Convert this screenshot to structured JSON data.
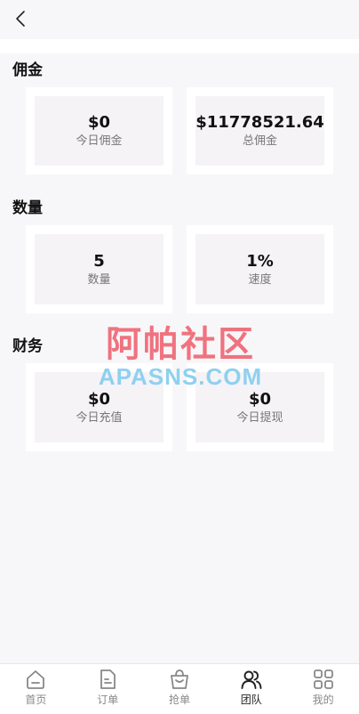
{
  "sections": [
    {
      "title": "佣金",
      "cards": [
        {
          "value": "$0",
          "label": "今日佣金"
        },
        {
          "value": "$11778521.64",
          "label": "总佣金"
        }
      ]
    },
    {
      "title": "数量",
      "cards": [
        {
          "value": "5",
          "label": "数量"
        },
        {
          "value": "1%",
          "label": "速度"
        }
      ]
    },
    {
      "title": "财务",
      "cards": [
        {
          "value": "$0",
          "label": "今日充值"
        },
        {
          "value": "$0",
          "label": "今日提现"
        }
      ]
    }
  ],
  "watermark": {
    "cn": "阿帕社区",
    "en": "APASNS.COM"
  },
  "tabbar": {
    "items": [
      {
        "label": "首页",
        "icon": "home-icon"
      },
      {
        "label": "订单",
        "icon": "document-icon"
      },
      {
        "label": "抢单",
        "icon": "shopping-bag-icon"
      },
      {
        "label": "团队",
        "icon": "team-icon",
        "active": true
      },
      {
        "label": "我的",
        "icon": "grid-icon"
      }
    ]
  },
  "colors": {
    "background": "#f7f7f9",
    "card_inner": "#f5f3f6",
    "watermark_cn": "#f0727f",
    "watermark_en": "#8fd0f0"
  }
}
